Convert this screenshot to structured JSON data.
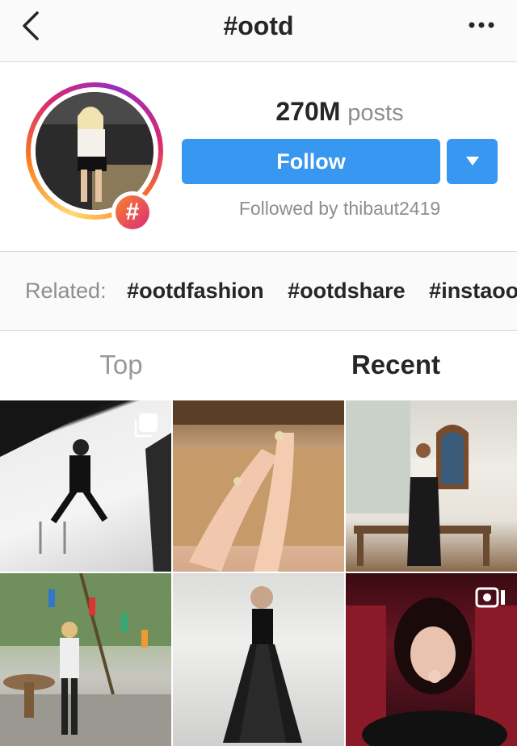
{
  "header": {
    "title": "#ootd"
  },
  "profile": {
    "posts_count": "270M",
    "posts_label": "posts",
    "follow_label": "Follow",
    "followed_by": "Followed by thibaut2419",
    "badge": "#"
  },
  "related": {
    "label": "Related:",
    "tags": [
      "#ootdfashion",
      "#ootdshare",
      "#instaootd"
    ]
  },
  "tabs": {
    "top": "Top",
    "recent": "Recent",
    "active": "Recent"
  },
  "grid": {
    "tiles": [
      {
        "desc": "man in suit on stool, black and white",
        "badge": "multiple-posts-icon"
      },
      {
        "desc": "hands with rings and bracelet",
        "badge": ""
      },
      {
        "desc": "woman in black dress by wall",
        "badge": ""
      },
      {
        "desc": "person under tree with colorful ribbons",
        "badge": ""
      },
      {
        "desc": "woman in black gown",
        "badge": ""
      },
      {
        "desc": "woman in red cinema seats",
        "badge": "video-icon"
      }
    ]
  },
  "colors": {
    "accent": "#3897f0",
    "muted": "#8e8e8e",
    "text": "#262626",
    "border": "#dbdbdb"
  }
}
